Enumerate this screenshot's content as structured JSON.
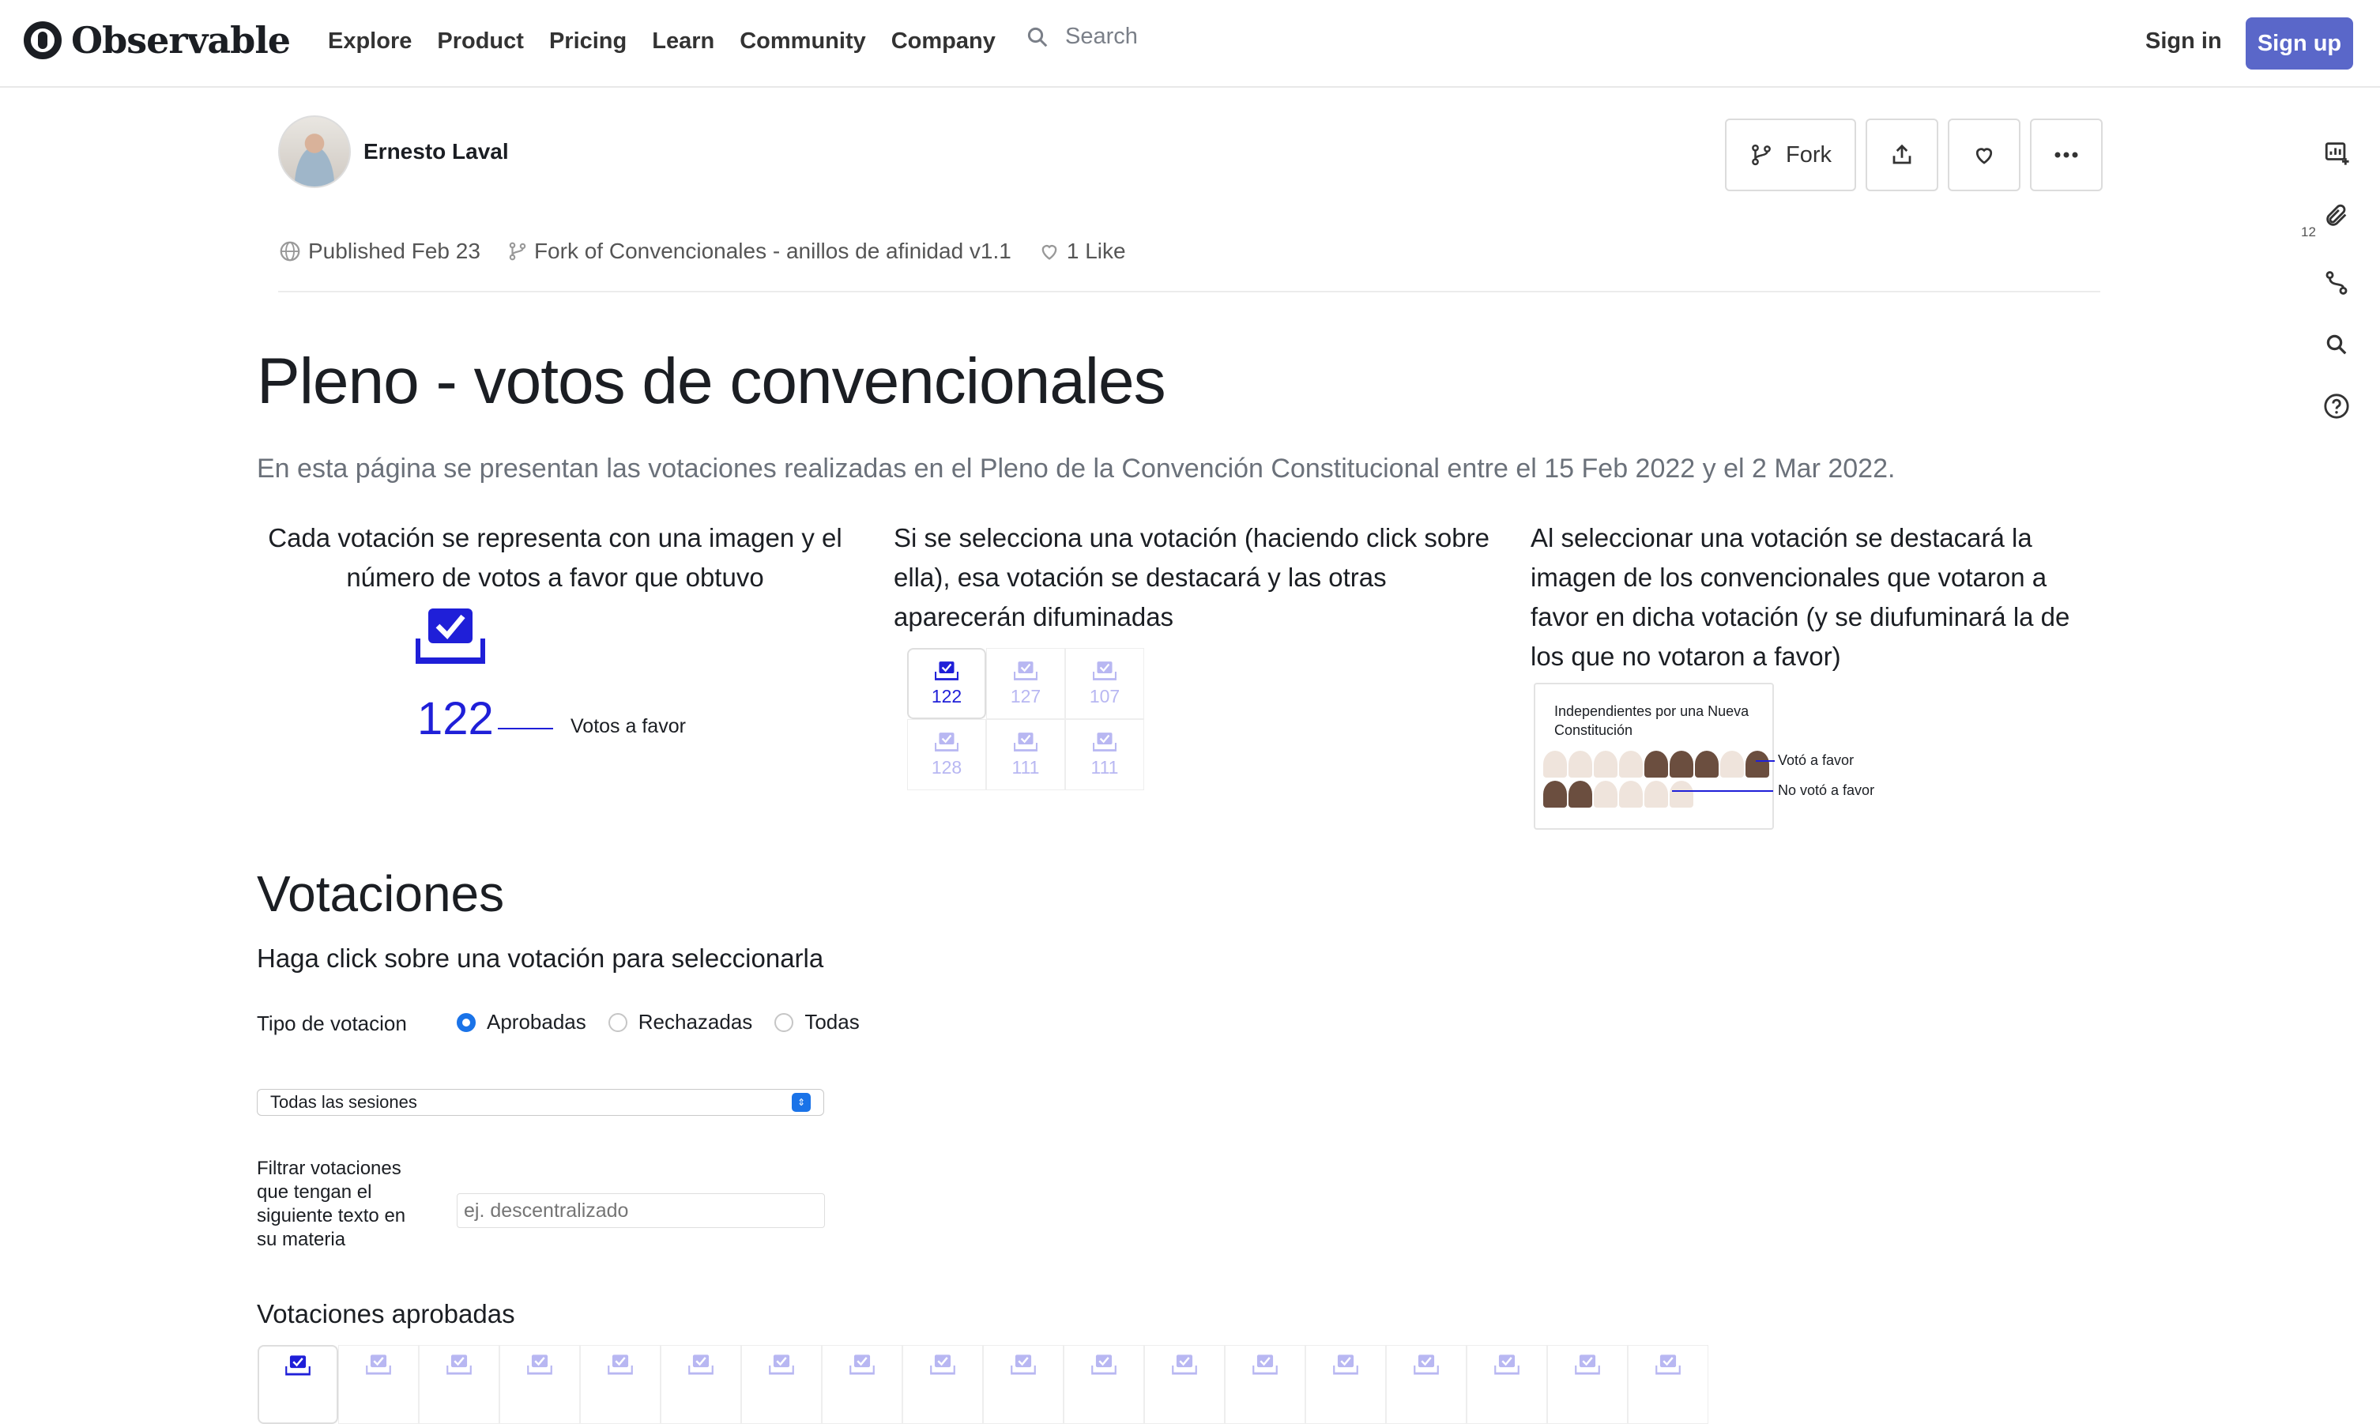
{
  "brand": {
    "name": "Observable"
  },
  "nav": {
    "items": [
      "Explore",
      "Product",
      "Pricing",
      "Learn",
      "Community",
      "Company"
    ]
  },
  "search": {
    "placeholder": "Search"
  },
  "auth": {
    "sign_in": "Sign in",
    "sign_up": "Sign up"
  },
  "author": {
    "name": "Ernesto Laval"
  },
  "actions": {
    "fork": "Fork"
  },
  "meta": {
    "published": "Published Feb 23",
    "fork_of": "Fork of Convencionales - anillos de afinidad v1.1",
    "likes": "1 Like"
  },
  "rail": {
    "comments_count": "12"
  },
  "page": {
    "title": "Pleno - votos de convencionales",
    "lead": "En esta página se presentan las votaciones realizadas en el Pleno de la Convención Constitucional entre el 15 Feb 2022 y el 2 Mar 2022.",
    "col1": "Cada votación se representa con una imagen y el número de votos a favor que obtuvo",
    "col2": "Si se selecciona una votación (haciendo click sobre ella), esa votación se destacará y las otras aparecerán difuminadas",
    "col3": "Al seleccionar una votación se destacará la imagen de los convencionales que votaron a favor en dicha votación (y se diufuminará la de los que no votaron a favor)"
  },
  "illus1": {
    "value": "122",
    "label": "Votos a favor"
  },
  "illus2": {
    "values": [
      "122",
      "127",
      "107",
      "128",
      "111",
      "111"
    ]
  },
  "illus3": {
    "title": "Independientes por una Nueva Constitución",
    "voted_yes": "Votó a favor",
    "voted_no": "No votó a favor"
  },
  "votaciones": {
    "heading": "Votaciones",
    "hint": "Haga click sobre una votación para seleccionarla",
    "tipo_label": "Tipo de votacion",
    "radios": [
      {
        "label": "Aprobadas",
        "checked": true
      },
      {
        "label": "Rechazadas",
        "checked": false
      },
      {
        "label": "Todas",
        "checked": false
      }
    ],
    "session_select": "Todas las sesiones",
    "filter_label": "Filtrar votaciones que tengan el siguiente texto en su materia",
    "filter_placeholder": "ej. descentralizado",
    "aprobadas_heading": "Votaciones aprobadas",
    "cards": 18
  },
  "colors": {
    "accent": "#5a67c9",
    "vote_blue": "#1f1fd8",
    "faded": "#b8b7f2",
    "radio": "#1a73e8"
  }
}
